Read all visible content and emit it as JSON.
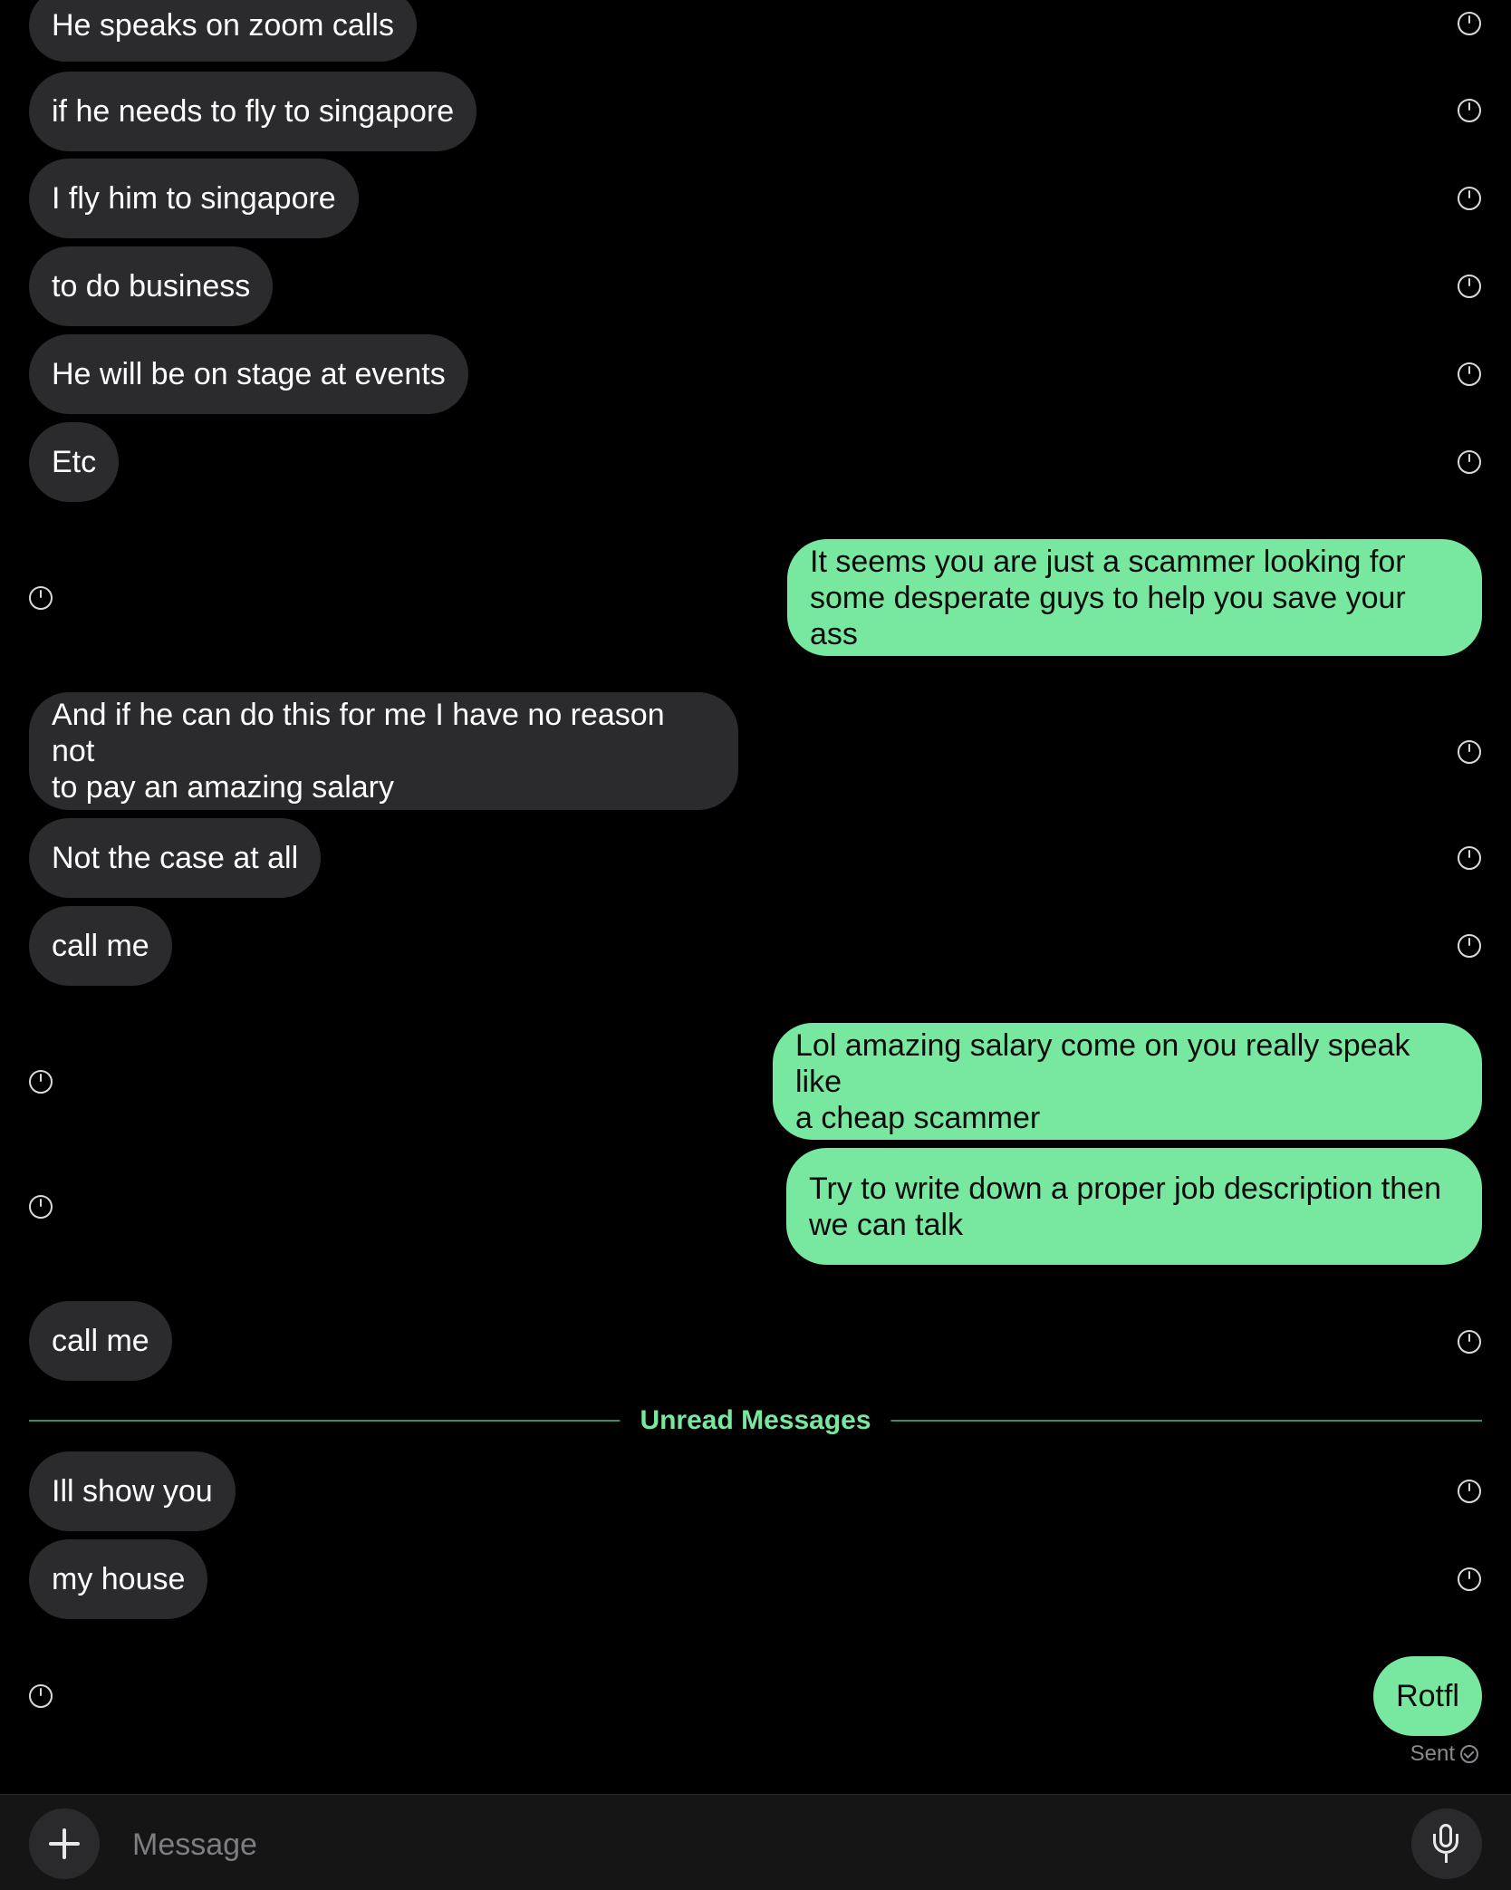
{
  "messages": [
    {
      "dir": "in",
      "text": "He speaks on zoom calls"
    },
    {
      "dir": "in",
      "text": "if he needs to fly to singapore"
    },
    {
      "dir": "in",
      "text": "I fly him to singapore"
    },
    {
      "dir": "in",
      "text": "to do business"
    },
    {
      "dir": "in",
      "text": "He will be on stage at events"
    },
    {
      "dir": "in",
      "text": "Etc"
    },
    {
      "dir": "out",
      "text": "It seems you are just a scammer looking for\nsome desperate guys to help you save your ass"
    },
    {
      "dir": "in",
      "text": "And if he can do this for me I have no reason not\nto pay an amazing salary"
    },
    {
      "dir": "in",
      "text": "Not the case at all"
    },
    {
      "dir": "in",
      "text": "call me"
    },
    {
      "dir": "out",
      "text": "Lol amazing salary come on you really speak like\na cheap scammer"
    },
    {
      "dir": "out",
      "text": "Try to write down a proper job description then\nwe can talk"
    },
    {
      "dir": "in",
      "text": "call me"
    },
    {
      "dir": "in",
      "text": "Ill show you"
    },
    {
      "dir": "in",
      "text": "my house"
    },
    {
      "dir": "out",
      "text": "Rotfl"
    }
  ],
  "unread_divider": "Unread Messages",
  "delivery_status": "Sent",
  "composer": {
    "placeholder": "Message",
    "plus_icon": "plus-icon",
    "mic_icon": "microphone-icon"
  },
  "colors": {
    "background": "#000000",
    "incoming_bubble": "#2b2b2d",
    "outgoing_bubble": "#78e79f",
    "accent": "#78e79f"
  }
}
